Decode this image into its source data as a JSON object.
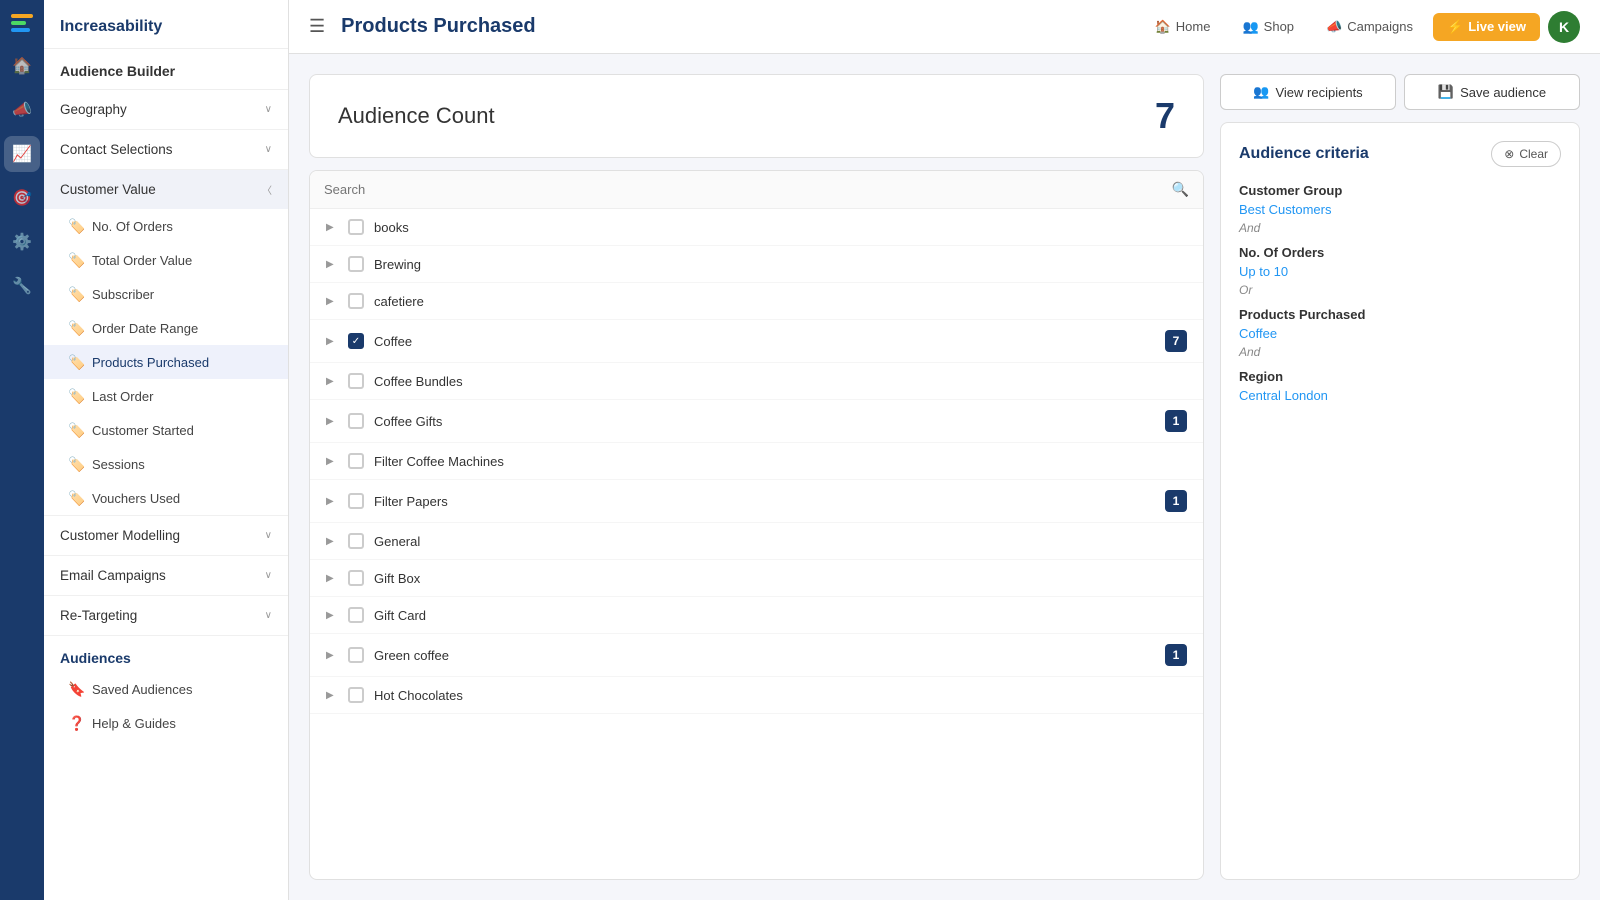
{
  "app": {
    "logo_bars": [
      "#f5a623",
      "#4cd964",
      "#2196f3"
    ],
    "name": "Increasability",
    "page_title": "Products Purchased"
  },
  "topbar": {
    "title": "Products Purchased",
    "nav_items": [
      {
        "label": "Home",
        "icon": "🏠"
      },
      {
        "label": "Shop",
        "icon": "👥"
      },
      {
        "label": "Campaigns",
        "icon": "📣"
      }
    ],
    "live_view": "Live view",
    "avatar": "K"
  },
  "sidebar": {
    "header": "Audience Builder",
    "sections": [
      {
        "label": "Geography",
        "expandable": true
      },
      {
        "label": "Contact Selections",
        "expandable": true
      },
      {
        "label": "Customer Value",
        "expandable": true,
        "expanded": true
      }
    ],
    "customer_value_items": [
      {
        "label": "No. Of Orders",
        "active": false
      },
      {
        "label": "Total Order Value",
        "active": false
      },
      {
        "label": "Subscriber",
        "active": false
      },
      {
        "label": "Order Date Range",
        "active": false
      },
      {
        "label": "Products Purchased",
        "active": true
      },
      {
        "label": "Last Order",
        "active": false
      },
      {
        "label": "Customer Started",
        "active": false
      },
      {
        "label": "Sessions",
        "active": false
      },
      {
        "label": "Vouchers Used",
        "active": false
      }
    ],
    "bottom_sections": [
      {
        "label": "Customer Modelling",
        "expandable": true
      },
      {
        "label": "Email Campaigns",
        "expandable": true
      },
      {
        "label": "Re-Targeting",
        "expandable": true
      }
    ],
    "audiences_header": "Audiences",
    "audiences_items": [
      {
        "label": "Saved Audiences"
      },
      {
        "label": "Help & Guides"
      }
    ]
  },
  "audience_count": {
    "label": "Audience Count",
    "value": "7"
  },
  "search": {
    "placeholder": "Search"
  },
  "products": [
    {
      "name": "books",
      "checked": false,
      "badge": null
    },
    {
      "name": "Brewing",
      "checked": false,
      "badge": null
    },
    {
      "name": "cafetiere",
      "checked": false,
      "badge": null
    },
    {
      "name": "Coffee",
      "checked": true,
      "badge": "7"
    },
    {
      "name": "Coffee Bundles",
      "checked": false,
      "badge": null
    },
    {
      "name": "Coffee Gifts",
      "checked": false,
      "badge": "1"
    },
    {
      "name": "Filter Coffee Machines",
      "checked": false,
      "badge": null
    },
    {
      "name": "Filter Papers",
      "checked": false,
      "badge": "1"
    },
    {
      "name": "General",
      "checked": false,
      "badge": null
    },
    {
      "name": "Gift Box",
      "checked": false,
      "badge": null
    },
    {
      "name": "Gift Card",
      "checked": false,
      "badge": null
    },
    {
      "name": "Green coffee",
      "checked": false,
      "badge": "1"
    },
    {
      "name": "Hot Chocolates",
      "checked": false,
      "badge": null
    }
  ],
  "actions": {
    "view_recipients": "View recipients",
    "save_audience": "Save audience"
  },
  "criteria": {
    "title": "Audience criteria",
    "clear_label": "Clear",
    "groups": [
      {
        "title": "Customer Group",
        "value": "Best Customers",
        "connector": "And"
      },
      {
        "title": "No. Of Orders",
        "value": "Up to 10",
        "connector": "Or"
      },
      {
        "title": "Products Purchased",
        "value": "Coffee",
        "connector": "And"
      },
      {
        "title": "Region",
        "value": "Central London",
        "connector": null
      }
    ]
  },
  "icons": {
    "home": "🏠",
    "shop": "👥",
    "campaigns": "📣",
    "analytics": "📈",
    "targeting": "🎯",
    "settings": "⚙️",
    "tools": "🔧",
    "lightning": "⚡",
    "search": "🔍",
    "check": "✓",
    "expand": "▶",
    "close": "⊗",
    "recipients": "👥",
    "save": "💾",
    "tag": "🏷️"
  }
}
